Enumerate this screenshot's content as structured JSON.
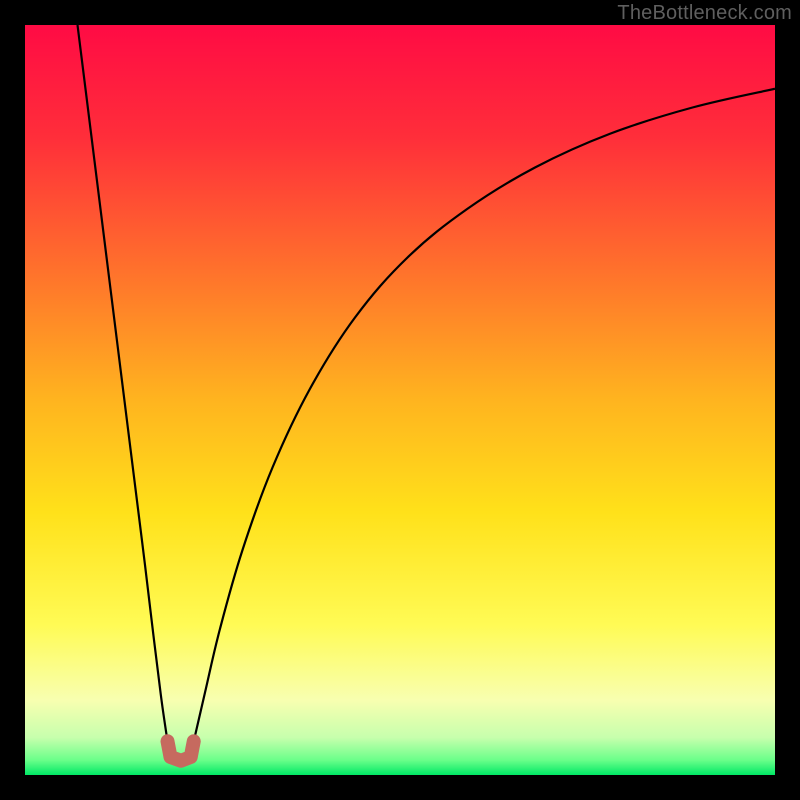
{
  "watermark": "TheBottleneck.com",
  "chart_data": {
    "type": "line",
    "title": "",
    "xlabel": "",
    "ylabel": "",
    "xlim": [
      0,
      100
    ],
    "ylim": [
      0,
      100
    ],
    "grid": false,
    "legend": false,
    "background": {
      "kind": "vertical_gradient",
      "description": "Smooth heatmap gradient: red (high y) → orange → yellow → green (low y), with a thin bright green band at the very bottom.",
      "stops": [
        {
          "y": 100,
          "color": "#ff0b44"
        },
        {
          "y": 85,
          "color": "#ff2e3a"
        },
        {
          "y": 65,
          "color": "#ff7a2a"
        },
        {
          "y": 50,
          "color": "#ffb41f"
        },
        {
          "y": 35,
          "color": "#ffe11a"
        },
        {
          "y": 20,
          "color": "#fffb55"
        },
        {
          "y": 10,
          "color": "#f8ffb0"
        },
        {
          "y": 5,
          "color": "#c7ffad"
        },
        {
          "y": 2,
          "color": "#6bff8a"
        },
        {
          "y": 0,
          "color": "#00e865"
        }
      ]
    },
    "series": [
      {
        "name": "left_branch",
        "stroke": "#000000",
        "points": [
          {
            "x": 7.0,
            "y": 100.0
          },
          {
            "x": 8.5,
            "y": 88.0
          },
          {
            "x": 10.0,
            "y": 76.0
          },
          {
            "x": 11.5,
            "y": 64.0
          },
          {
            "x": 13.0,
            "y": 52.0
          },
          {
            "x": 14.5,
            "y": 40.0
          },
          {
            "x": 16.0,
            "y": 28.0
          },
          {
            "x": 17.2,
            "y": 18.0
          },
          {
            "x": 18.2,
            "y": 10.0
          },
          {
            "x": 19.0,
            "y": 4.5
          }
        ]
      },
      {
        "name": "right_branch",
        "stroke": "#000000",
        "points": [
          {
            "x": 22.5,
            "y": 4.5
          },
          {
            "x": 24.0,
            "y": 11.0
          },
          {
            "x": 26.0,
            "y": 19.5
          },
          {
            "x": 29.0,
            "y": 30.0
          },
          {
            "x": 33.0,
            "y": 41.0
          },
          {
            "x": 38.0,
            "y": 51.5
          },
          {
            "x": 44.0,
            "y": 61.0
          },
          {
            "x": 51.0,
            "y": 69.0
          },
          {
            "x": 59.0,
            "y": 75.5
          },
          {
            "x": 68.0,
            "y": 81.0
          },
          {
            "x": 78.0,
            "y": 85.5
          },
          {
            "x": 89.0,
            "y": 89.0
          },
          {
            "x": 100.0,
            "y": 91.5
          }
        ]
      },
      {
        "name": "valley_marker",
        "kind": "shape",
        "stroke": "#c66a5f",
        "stroke_width": 8,
        "description": "Small U-shaped marker at the valley bottom joining the two branches.",
        "points": [
          {
            "x": 19.0,
            "y": 4.5
          },
          {
            "x": 19.4,
            "y": 2.4
          },
          {
            "x": 20.8,
            "y": 1.9
          },
          {
            "x": 22.1,
            "y": 2.4
          },
          {
            "x": 22.5,
            "y": 4.5
          }
        ]
      }
    ]
  }
}
